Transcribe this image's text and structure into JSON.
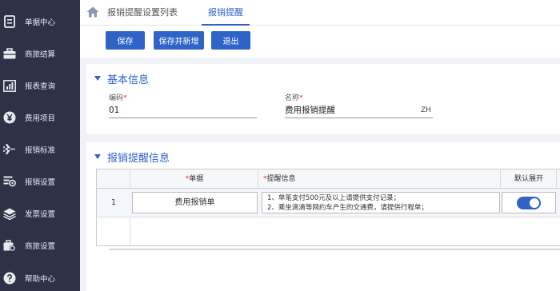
{
  "sidebar": {
    "items": [
      {
        "label": "单据中心",
        "icon": "document-icon"
      },
      {
        "label": "商旅结算",
        "icon": "briefcase-icon"
      },
      {
        "label": "报表查询",
        "icon": "chart-icon"
      },
      {
        "label": "费用项目",
        "icon": "yen-icon"
      },
      {
        "label": "报销标准",
        "icon": "airplane-icon"
      },
      {
        "label": "报销设置",
        "icon": "settings-card-icon"
      },
      {
        "label": "发票设置",
        "icon": "layers-icon"
      },
      {
        "label": "商旅设置",
        "icon": "bag-gear-icon"
      },
      {
        "label": "帮助中心",
        "icon": "help-icon"
      }
    ]
  },
  "tabs": [
    {
      "label": "报销提醒设置列表"
    },
    {
      "label": "报销提醒"
    }
  ],
  "toolbar": {
    "save_label": "保存",
    "save_new_label": "保存并新增",
    "exit_label": "退出"
  },
  "basic_info": {
    "title": "基本信息",
    "code_label": "编码",
    "code_value": "01",
    "name_label": "名称",
    "name_value": "费用报销提醒",
    "name_lang": "ZH",
    "required_mark": "*"
  },
  "reminder_info": {
    "title": "报销提醒信息",
    "columns": {
      "document": "单据",
      "message": "提醒信息",
      "default_expand": "默认展开"
    },
    "rows": [
      {
        "index": "1",
        "document": "费用报销单",
        "message_line1": "1、单笔支付500元及以上请提供支付记录；",
        "message_line2": "2、乘坐滴滴等网约车产生的交通费，请提供行程单；",
        "default_expand": true
      }
    ]
  },
  "colors": {
    "sidebar_bg": "#2d3345",
    "accent": "#2f63c8",
    "required": "#e23333"
  }
}
